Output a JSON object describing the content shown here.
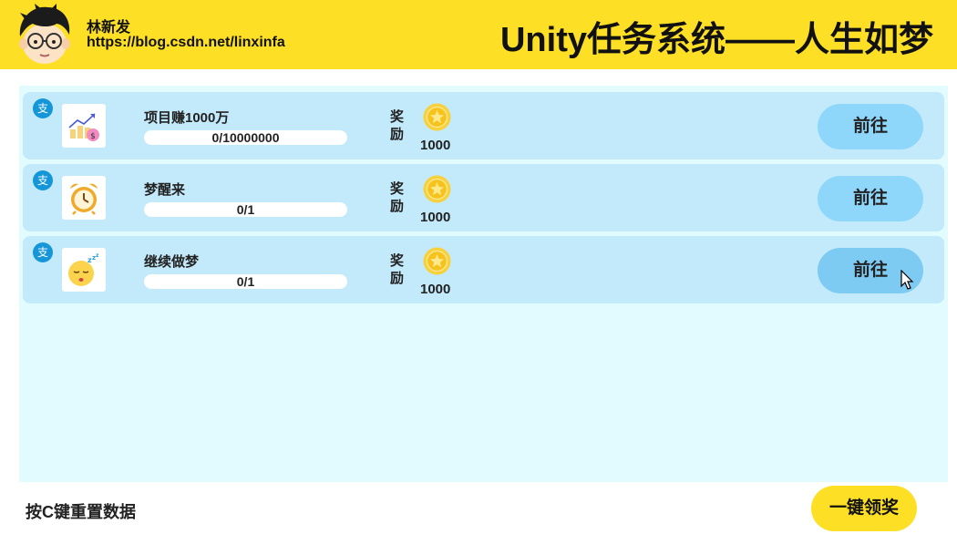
{
  "header": {
    "author_name": "林新发",
    "author_url": "https://blog.csdn.net/linxinfa",
    "title": "Unity任务系统——人生如梦",
    "accent_color": "#fde025"
  },
  "tasks": [
    {
      "badge": "支",
      "icon": "growth-chart-icon",
      "name": "项目赚1000万",
      "progress_text": "0/10000000",
      "progress_value": 0,
      "reward_label": "奖励",
      "reward_icon": "gold-coin-icon",
      "reward_value": "1000",
      "button_label": "前往"
    },
    {
      "badge": "支",
      "icon": "alarm-clock-icon",
      "name": "梦醒来",
      "progress_text": "0/1",
      "progress_value": 0,
      "reward_label": "奖励",
      "reward_icon": "gold-coin-icon",
      "reward_value": "1000",
      "button_label": "前往"
    },
    {
      "badge": "支",
      "icon": "sleeping-face-icon",
      "name": "继续做梦",
      "progress_text": "0/1",
      "progress_value": 0,
      "reward_label": "奖励",
      "reward_icon": "gold-coin-icon",
      "reward_value": "1000",
      "button_label": "前往"
    }
  ],
  "footer": {
    "hint": "按C键重置数据",
    "claim_all_label": "一键领奖"
  },
  "colors": {
    "row_bg": "#c2eafb",
    "panel_bg": "#e2fbfe",
    "button_bg": "#8fd6fb",
    "badge_bg": "#1596d9"
  }
}
